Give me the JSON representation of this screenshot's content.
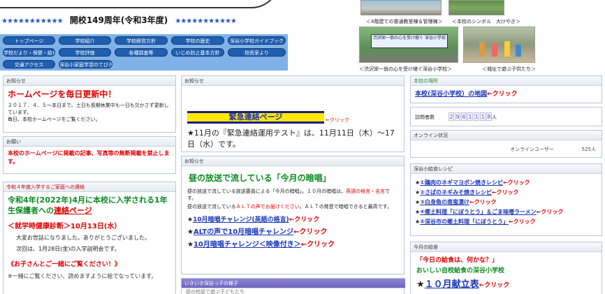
{
  "header": {
    "stars_left": "★★★★★★★★★★★",
    "anniversary": "開校149周年(令和3年度)",
    "stars_right": "★★★★★★★★★★★"
  },
  "nav": {
    "row1": [
      "トップページ",
      "学校紹介",
      "学校経営方針",
      "学校の歴史",
      "深谷小学校ガイドブック"
    ],
    "row2": [
      "学校だより・保健・給食",
      "学校評価",
      "各種調査等",
      "いじめ防止基本方針",
      "校長室より"
    ],
    "row3": [
      "交通アクセス",
      "深谷小家庭学習のてびき"
    ]
  },
  "photos": {
    "cap1": "＜4階建ての普通教室棟＆管理棟＞",
    "cap2": "＜本校のシンボル　大けやき＞",
    "cap3": "＜渋沢栄一翁の心を受け継ぐ深谷小学校＞",
    "cap4": "＜城址で遊ぶ子供たち＞",
    "banner_text": "渋沢栄一翁の心を受け継ぐ 深谷小学校"
  },
  "left": {
    "notice1_header": "お知らせ",
    "notice1_title": "ホームページを毎日更新中！",
    "notice1_body": "２０１７．４．５〜本日まで、土日も長期休業中も一日も欠かさず更新しています。",
    "notice1_body2": "毎日、本校ホームページをご覧ください。",
    "request_header": "お願い",
    "request_body": "本校のホームページに掲載の記事、写真等の無断掲載を禁止します。",
    "entry_header": "令和４年度入学するご家庭への連絡",
    "entry_title1": "令和4年(2022年)4月に本校に入学される1年生保護者への",
    "entry_title_link": "連絡ページ",
    "health_check": "＜就学時健康診断＞10月13日(水）",
    "thanks": "大変お世話になりました。ありがとうございました。",
    "next_meeting": "次回は、1月28日(金)の入学説明会です。",
    "please_see": "《お子さんとご一緒にご覧ください！》",
    "cut_text": "※一緒にご覧ください、読めますように絵でなっています。"
  },
  "center": {
    "notice_header": "お知らせ",
    "emergency_banner": "緊急連絡ページ",
    "click": "←クリック",
    "test_notice": "★11月の『緊急連絡運用テスト』は、11月11日（木）〜17日（水）です。",
    "notice2_header": "お知らせ",
    "recite_title": "昼の放送で流している「今月の暗唱」",
    "recite_body1": "昼の放送で流している放送委員による「今月の暗唱」。１０月の暗唱は、",
    "recite_body_red": "英語の格言・名言",
    "recite_body2": "です。",
    "recite_body3a": "昼の放送で流している",
    "recite_body_alt": "ＡＬＴの声でお届けください",
    "recite_body3b": "。ＡＬＴの発音で暗唱できると最高です。",
    "link1": "10月暗唱チャレンジ(英語の格言)",
    "link2": "ALTの声で10月暗唱チャレンジ",
    "link3": "10月暗唱チャレンジ＜映像付き＞",
    "kids_header": "いきいき深谷っ子の様子",
    "kids_cut": "昼の校庭で遊ぶ子どもたち"
  },
  "right": {
    "location_header": "本校の場所",
    "map_link": "本校(深谷小学校）の地図",
    "visits_label": "訪問者数",
    "visits_digits": [
      "2",
      "9",
      "6",
      "1",
      "1",
      "1",
      "8"
    ],
    "visits_unit": "人",
    "online_header": "オンライン状況",
    "online_label": "オンラインユーザー",
    "online_count": "525人",
    "recipe_header": "深谷小給食レシピ",
    "recipes": [
      {
        "text": "①鶏肉のネギマヨポン焼きレシピ"
      },
      {
        "text": "②さばのネギみそ焼きレシピ"
      },
      {
        "text": "③白身魚の南蛮漬け"
      },
      {
        "text": "④郷土料理「にぼうとう」＆ごま味噌ラーメン"
      },
      {
        "text": "⑤深谷市の郷土料理「にぼうとう」"
      }
    ],
    "lunch_header": "今月の給食",
    "lunch_q": "「今日の給食は、何かな？」",
    "lunch_sub": "おいしい自校給食の深谷小学校",
    "menu_link": "１０月献立表",
    "click": "←クリック"
  },
  "colors": {
    "nav_bg": "#7fb2e6",
    "nav_btn": "#1f5fb0",
    "accent_red": "#e00000",
    "link_blue": "#1a35b8",
    "green": "#0a8a20"
  }
}
